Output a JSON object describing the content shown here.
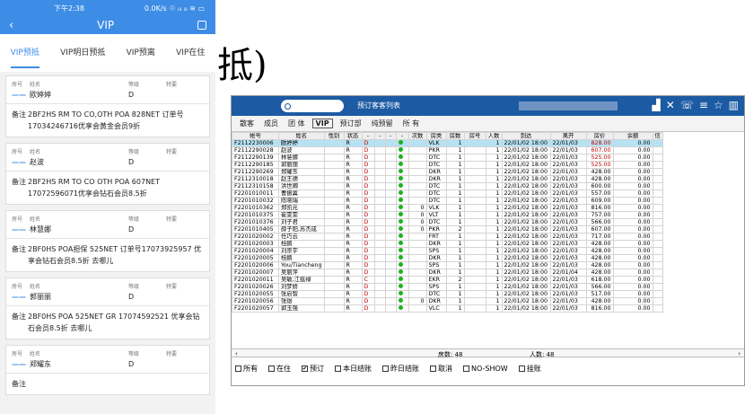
{
  "mobile": {
    "status_time": "下午2:38",
    "status_right": "0.0K/s ☉ ᵢₗₗ ᵢₗₗ ≋ ▭",
    "nav_title": "VIP",
    "tabs": [
      "VIP预抵",
      "VIP明日预抵",
      "VIP预离",
      "VIP在住"
    ],
    "active_tab": 0,
    "header_labels": {
      "room": "房号",
      "name": "姓名",
      "level": "等级",
      "special": "特要"
    },
    "memo_label": "备注",
    "cards": [
      {
        "room": "——",
        "name": "欧婷婷",
        "level": "D",
        "memo": "2BF2HS RM TO CO,OTH POA 828NET 订单号17034246716优享会黄金会员9折"
      },
      {
        "room": "——",
        "name": "赵波",
        "level": "D",
        "memo": "2BF2HS RM TO CO OTH POA 607NET 17072596071优享会钻石会员8.5折"
      },
      {
        "room": "——",
        "name": "林慧娜",
        "level": "D",
        "memo": "2BF0HS POA担保 525NET 订单号17073925957 优享会钻石会员8.5折 去哪儿"
      },
      {
        "room": "——",
        "name": "郭丽丽",
        "level": "D",
        "memo": "2BF0HS POA 525NET GR 17074592521 优享会钻石会员8.5折 去哪儿"
      },
      {
        "room": "——",
        "name": "郑耀东",
        "level": "D",
        "memo": ""
      }
    ]
  },
  "overlay_text": "抵)",
  "desktop": {
    "title": "预订客客列表",
    "icons": [
      "signal-icon",
      "tools-icon",
      "phone-icon",
      "menu-icon",
      "star-icon",
      "grid-icon"
    ],
    "tabs": [
      "散客",
      "成员",
      "团 体",
      "VIP",
      "预订部",
      "纯预留",
      "所 有"
    ],
    "selected_tab": 3,
    "columns": [
      "帐号",
      "姓名",
      "性别",
      "状态",
      "-",
      "-",
      "-",
      "-",
      "次数",
      "房类",
      "房数",
      "房号",
      "人数",
      "到达",
      "离开",
      "房价",
      "余额",
      "信"
    ],
    "rows": [
      [
        "F2112230006",
        "欧婷婷",
        "",
        "R",
        "D",
        "",
        "",
        "●",
        "",
        "VLK",
        "1",
        "",
        "1",
        "22/01/02 18:00",
        "22/01/03",
        "828.00",
        "0.00"
      ],
      [
        "F2112290028",
        "赵波",
        "",
        "R",
        "D",
        "",
        "",
        "●",
        "",
        "PKR",
        "1",
        "",
        "1",
        "22/01/02 18:00",
        "22/01/03",
        "607.00",
        "0.00"
      ],
      [
        "F2112290139",
        "林慧娜",
        "",
        "R",
        "D",
        "",
        "",
        "●",
        "",
        "DTC",
        "1",
        "",
        "1",
        "22/01/02 18:00",
        "22/01/03",
        "525.00",
        "0.00"
      ],
      [
        "F2112290185",
        "郭丽丽",
        "",
        "R",
        "D",
        "",
        "",
        "●",
        "",
        "DTC",
        "1",
        "",
        "1",
        "22/01/02 18:00",
        "22/01/03",
        "525.00",
        "0.00"
      ],
      [
        "F2112290269",
        "郑耀东",
        "",
        "R",
        "D",
        "",
        "",
        "●",
        "",
        "DKR",
        "1",
        "",
        "1",
        "22/01/02 18:00",
        "22/01/03",
        "428.00",
        "0.00"
      ],
      [
        "F2112310018",
        "赵王德",
        "",
        "R",
        "D",
        "",
        "",
        "●",
        "",
        "DKR",
        "1",
        "",
        "1",
        "22/01/02 18:00",
        "22/01/03",
        "428.00",
        "0.00"
      ],
      [
        "F2112310158",
        "洪世卿",
        "",
        "R",
        "D",
        "",
        "",
        "●",
        "",
        "DTC",
        "1",
        "",
        "1",
        "22/01/02 18:00",
        "22/01/03",
        "600.00",
        "0.00"
      ],
      [
        "F2201010011",
        "曹振翼",
        "",
        "R",
        "D",
        "",
        "",
        "●",
        "",
        "DTC",
        "1",
        "",
        "1",
        "22/01/02 18:00",
        "22/01/03",
        "557.00",
        "0.00"
      ],
      [
        "F2201010032",
        "陈晓瑞",
        "",
        "R",
        "D",
        "",
        "",
        "●",
        "",
        "DTC",
        "1",
        "",
        "1",
        "22/01/02 18:00",
        "22/01/03",
        "609.00",
        "0.00"
      ],
      [
        "F2201010362",
        "郑凯元",
        "",
        "R",
        "D",
        "",
        "",
        "●",
        "0",
        "VLK",
        "1",
        "",
        "1",
        "22/01/02 18:00",
        "22/01/03",
        "816.00",
        "0.00"
      ],
      [
        "F2201010375",
        "崔雯雯",
        "",
        "R",
        "D",
        "",
        "",
        "●",
        "0",
        "VLT",
        "1",
        "",
        "1",
        "22/01/02 18:00",
        "22/01/03",
        "757.00",
        "0.00"
      ],
      [
        "F2201010376",
        "刘子君",
        "",
        "R",
        "D",
        "",
        "",
        "●",
        "0",
        "DTC",
        "1",
        "",
        "1",
        "22/01/02 18:00",
        "22/01/03",
        "566.00",
        "0.00"
      ],
      [
        "F2201010405",
        "薛子阳,苏杰成",
        "",
        "R",
        "D",
        "",
        "",
        "●",
        "0",
        "PKR",
        "2",
        "",
        "1",
        "22/01/02 18:00",
        "22/01/03",
        "607.00",
        "0.00"
      ],
      [
        "F2201020002",
        "任巧云",
        "",
        "R",
        "D",
        "",
        "",
        "●",
        "",
        "FRT",
        "1",
        "",
        "1",
        "22/01/02 18:00",
        "22/01/03",
        "717.00",
        "0.00"
      ],
      [
        "F2201020003",
        "桂鹏",
        "",
        "R",
        "D",
        "",
        "",
        "●",
        "",
        "DKR",
        "1",
        "",
        "1",
        "22/01/02 18:00",
        "22/01/03",
        "428.00",
        "0.00"
      ],
      [
        "F2201020004",
        "刘崇宇",
        "",
        "R",
        "D",
        "",
        "",
        "●",
        "",
        "SPS",
        "1",
        "",
        "1",
        "22/01/02 18:00",
        "22/01/03",
        "428.00",
        "0.00"
      ],
      [
        "F2201020005",
        "桂鹏",
        "",
        "R",
        "D",
        "",
        "",
        "●",
        "",
        "DKR",
        "1",
        "",
        "1",
        "22/01/02 18:00",
        "22/01/03",
        "428.00",
        "0.00"
      ],
      [
        "F2201020006",
        "You/Tiancheng",
        "",
        "R",
        "D",
        "",
        "",
        "●",
        "",
        "SPS",
        "1",
        "",
        "1",
        "22/01/02 18:00",
        "22/01/03",
        "428.00",
        "0.00"
      ],
      [
        "F2201020007",
        "吴丽萍",
        "",
        "R",
        "D",
        "",
        "",
        "●",
        "",
        "DKR",
        "1",
        "",
        "1",
        "22/01/02 18:00",
        "22/01/04",
        "428.00",
        "0.00"
      ],
      [
        "F2201020011",
        "吴敏,江挺禄",
        "",
        "R",
        "C",
        "",
        "",
        "●",
        "",
        "EKR",
        "2",
        "",
        "1",
        "22/01/02 18:00",
        "22/01/03",
        "618.00",
        "0.00"
      ],
      [
        "F2201020026",
        "刘梦娇",
        "",
        "R",
        "D",
        "",
        "",
        "●",
        "",
        "SPS",
        "1",
        "",
        "1",
        "22/01/02 18:00",
        "22/01/03",
        "566.00",
        "0.00"
      ],
      [
        "F2201020055",
        "张启智",
        "",
        "R",
        "D",
        "",
        "",
        "●",
        "",
        "DTC",
        "1",
        "",
        "1",
        "22/01/02 18:00",
        "22/01/03",
        "517.00",
        "0.00"
      ],
      [
        "F2201020056",
        "张煜",
        "",
        "R",
        "D",
        "",
        "",
        "●",
        "0",
        "DKR",
        "1",
        "",
        "1",
        "22/01/02 18:00",
        "22/01/03",
        "428.00",
        "0.00"
      ],
      [
        "F2201020057",
        "郭玉强",
        "",
        "R",
        "D",
        "",
        "",
        "●",
        "",
        "VLC",
        "1",
        "",
        "1",
        "22/01/02 18:00",
        "22/01/03",
        "816.00",
        "0.00"
      ]
    ],
    "red_rate_rows": [
      0,
      1,
      2,
      3
    ],
    "footer_rooms": "房数: 48",
    "footer_people": "人数: 48",
    "checks": [
      {
        "label": "所有",
        "checked": false
      },
      {
        "label": "在住",
        "checked": false
      },
      {
        "label": "预订",
        "checked": true
      },
      {
        "label": "本日结账",
        "checked": false
      },
      {
        "label": "昨日结账",
        "checked": false
      },
      {
        "label": "取消",
        "checked": false
      },
      {
        "label": "NO-SHOW",
        "checked": false
      },
      {
        "label": "挂账",
        "checked": false
      }
    ],
    "colors": {
      "titlebar": "#1c5aa3",
      "selected_row": "#b6e2f3",
      "status_dot": "#1bb31b",
      "accent_mobile": "#3d8ce6"
    }
  }
}
